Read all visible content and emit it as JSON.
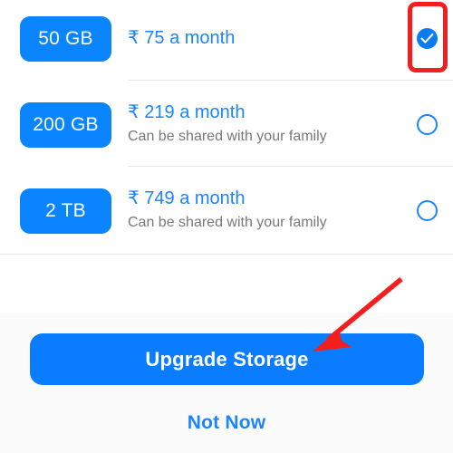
{
  "screen": {
    "title": "Upgrade Storage plan picker",
    "background": "#ffffff",
    "footer_background": "#fbfbfb"
  },
  "colors": {
    "accent_blue": "#0a7cff",
    "badge_blue": "#0a84ff",
    "price_blue": "#1a85ff",
    "radio_selected": "#0a7cf0",
    "subtitle_gray": "#787878",
    "divider_gray": "#e6e6e6",
    "annotation_red": "#f41e1e"
  },
  "plans": [
    {
      "storage": "50 GB",
      "price": "₹ 75 a month",
      "note": "",
      "selected": true,
      "radio_icon": "radio-checked-icon"
    },
    {
      "storage": "200 GB",
      "price": "₹ 219 a month",
      "note": "Can be shared with your family",
      "selected": false,
      "radio_icon": "radio-unchecked-icon"
    },
    {
      "storage": "2 TB",
      "price": "₹ 749 a month",
      "note": "Can be shared with your family",
      "selected": false,
      "radio_icon": "radio-unchecked-icon"
    }
  ],
  "footer": {
    "primary_button_label": "Upgrade Storage",
    "secondary_link_label": "Not Now"
  },
  "annotations": {
    "highlight_box": {
      "target": "selected-plan-radio",
      "shape": "rounded-rectangle",
      "color": "#f41e1e"
    },
    "arrow": {
      "target": "upgrade-storage-button",
      "color": "#f41e1e",
      "direction": "down-left"
    }
  }
}
